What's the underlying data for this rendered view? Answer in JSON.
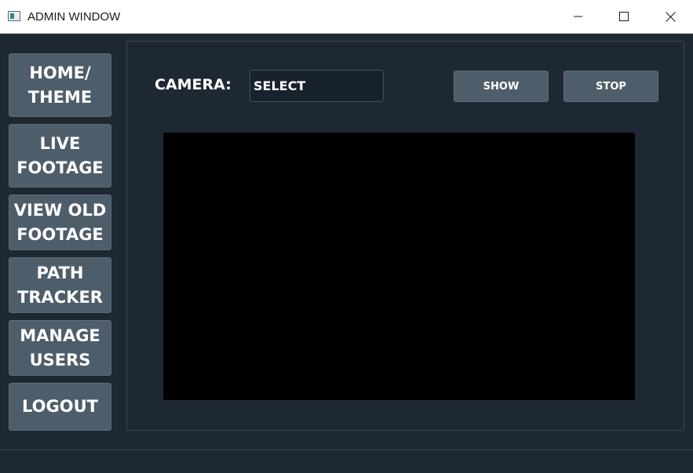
{
  "window": {
    "title": "ADMIN WINDOW"
  },
  "sidebar": {
    "items": [
      {
        "line1": "HOME/",
        "line2": "THEME"
      },
      {
        "line1": "LIVE",
        "line2": "FOOTAGE"
      },
      {
        "line1": "VIEW OLD",
        "line2": "FOOTAGE"
      },
      {
        "line1": "PATH",
        "line2": "TRACKER"
      },
      {
        "line1": "MANAGE",
        "line2": "USERS"
      },
      {
        "line1": "LOGOUT",
        "line2": ""
      }
    ]
  },
  "main": {
    "camera_label": "CAMERA:",
    "camera_select_value": "SELECT",
    "show_label": "SHOW",
    "stop_label": "STOP"
  },
  "colors": {
    "background": "#1e2833",
    "button": "#4e5d6a",
    "video": "#000000"
  }
}
